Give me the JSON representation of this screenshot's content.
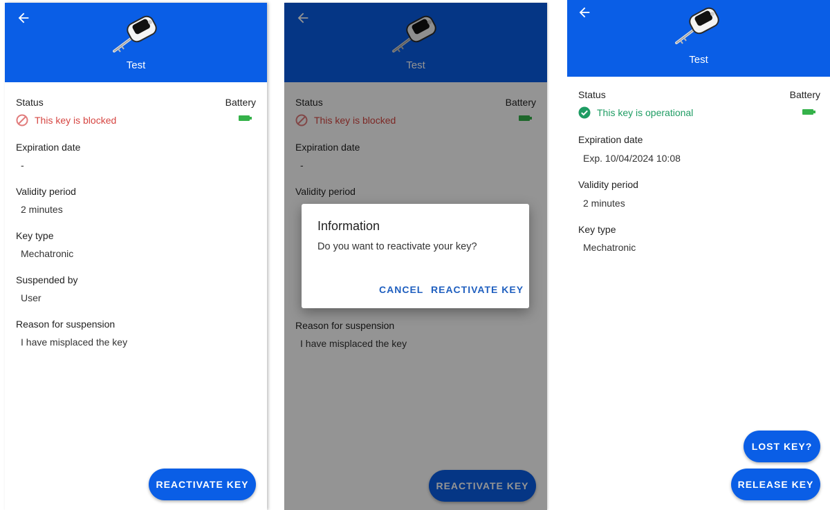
{
  "colors": {
    "primary": "#0a5ee6",
    "blocked_red": "#d64541",
    "ok_green": "#1e9c63",
    "battery_green": "#35b24a",
    "dialog_button": "#1f5fbf"
  },
  "icons": {
    "back": "arrow-left-icon",
    "key": "key-icon",
    "blocked": "blocked-icon",
    "ok": "check-circle-icon",
    "battery": "battery-icon"
  },
  "screen1": {
    "title": "Test",
    "status_label": "Status",
    "battery_label": "Battery",
    "status_text": "This key is blocked",
    "expiration_label": "Expiration date",
    "expiration_value": "-",
    "validity_label": "Validity period",
    "validity_value": "2 minutes",
    "keytype_label": "Key type",
    "keytype_value": "Mechatronic",
    "suspended_label": "Suspended by",
    "suspended_value": "User",
    "reason_label": "Reason for suspension",
    "reason_value": "I have misplaced the key",
    "reactivate_button": "REACTIVATE KEY"
  },
  "screen2": {
    "title": "Test",
    "status_label": "Status",
    "battery_label": "Battery",
    "status_text": "This key is blocked",
    "expiration_label": "Expiration date",
    "expiration_value": "-",
    "validity_label": "Validity period",
    "reason_label": "Reason for suspension",
    "reason_value": "I have misplaced the key",
    "reactivate_button": "REACTIVATE KEY",
    "dialog": {
      "title": "Information",
      "message": "Do you want to reactivate your key?",
      "cancel": "CANCEL",
      "confirm": "REACTIVATE KEY"
    }
  },
  "screen3": {
    "title": "Test",
    "status_label": "Status",
    "battery_label": "Battery",
    "status_text": "This key is operational",
    "expiration_label": "Expiration date",
    "expiration_value": "Exp. 10/04/2024 10:08",
    "validity_label": "Validity period",
    "validity_value": "2 minutes",
    "keytype_label": "Key type",
    "keytype_value": "Mechatronic",
    "lost_button": "LOST KEY?",
    "release_button": "RELEASE KEY"
  }
}
